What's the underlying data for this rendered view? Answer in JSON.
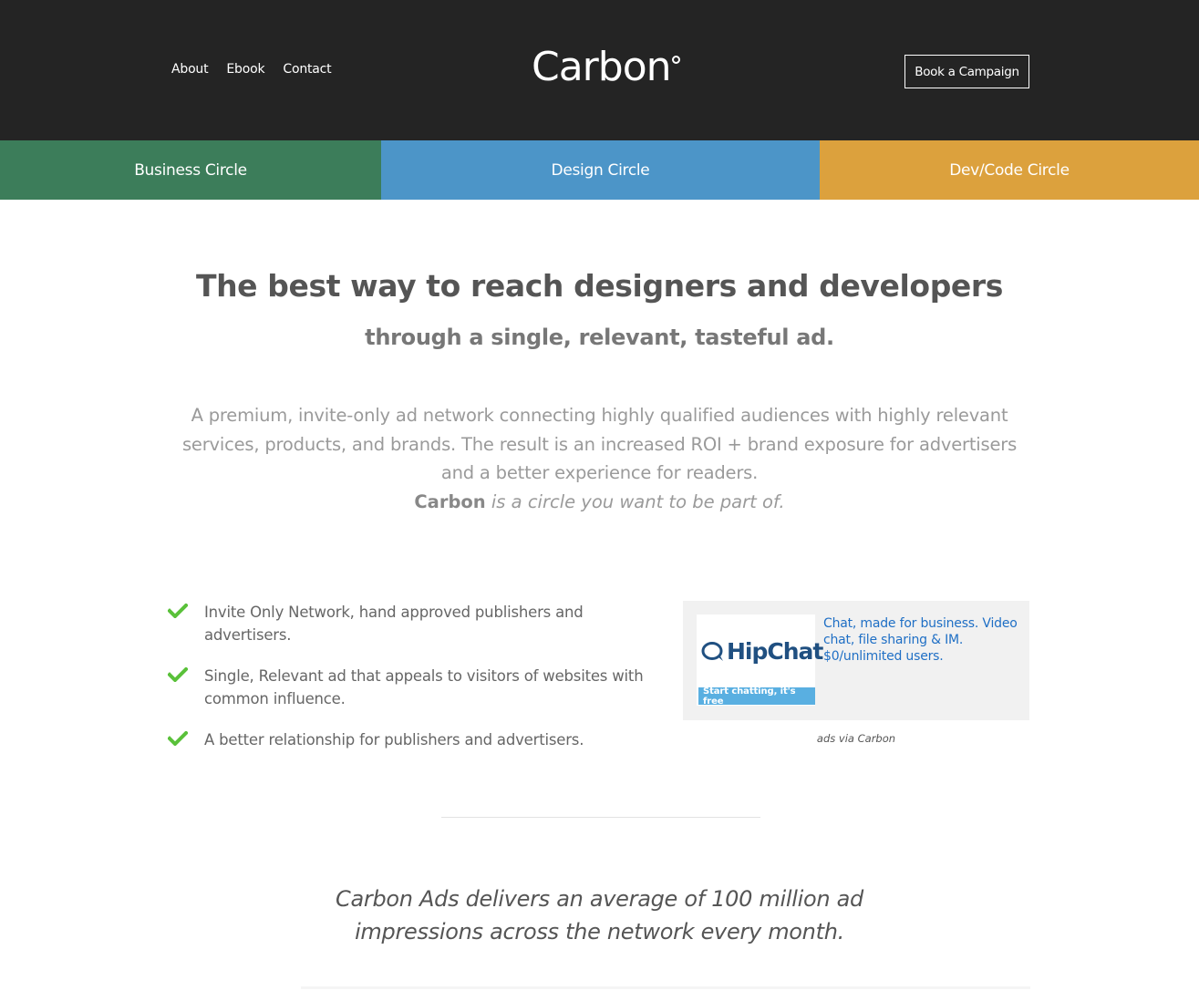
{
  "header": {
    "nav": [
      {
        "label": "About"
      },
      {
        "label": "Ebook"
      },
      {
        "label": "Contact"
      }
    ],
    "logo_text": "Carbon",
    "cta_label": "Book a Campaign"
  },
  "circles": [
    {
      "label": "Business Circle",
      "color": "#3c7d5a"
    },
    {
      "label": "Design Circle",
      "color": "#4c95c8"
    },
    {
      "label": "Dev/Code Circle",
      "color": "#dca13d"
    }
  ],
  "hero": {
    "headline": "The best way to reach designers and developers",
    "subheadline": "through a single, relevant, tasteful ad.",
    "intro": "A premium, invite-only ad network connecting highly qualified audiences with highly relevant services, products, and brands. The result is an increased ROI + brand exposure for advertisers and a better experience for readers.",
    "tagline_brand": "Carbon",
    "tagline_rest": "is a circle you want to be part of."
  },
  "features": [
    {
      "text": "Invite Only Network, hand approved publishers and advertisers.",
      "icon": "check-icon"
    },
    {
      "text": "Single, Relevant ad that appeals to visitors of websites with common influence.",
      "icon": "check-icon"
    },
    {
      "text": "A better relationship for publishers and advertisers.",
      "icon": "check-icon"
    }
  ],
  "ad": {
    "brand": "HipChat",
    "cta": "Start chatting, it's free",
    "text": "Chat, made for business. Video chat, file sharing & IM. $0/unlimited users.",
    "via": "ads via Carbon"
  },
  "stat": {
    "text": "Carbon Ads delivers an average of 100 million ad impressions across the network every month."
  },
  "colors": {
    "header_bg": "#242424",
    "check": "#5ac13a",
    "ad_link": "#1f6fc5",
    "hipchat_blue": "#205081",
    "hipchat_cta": "#59afe1"
  }
}
